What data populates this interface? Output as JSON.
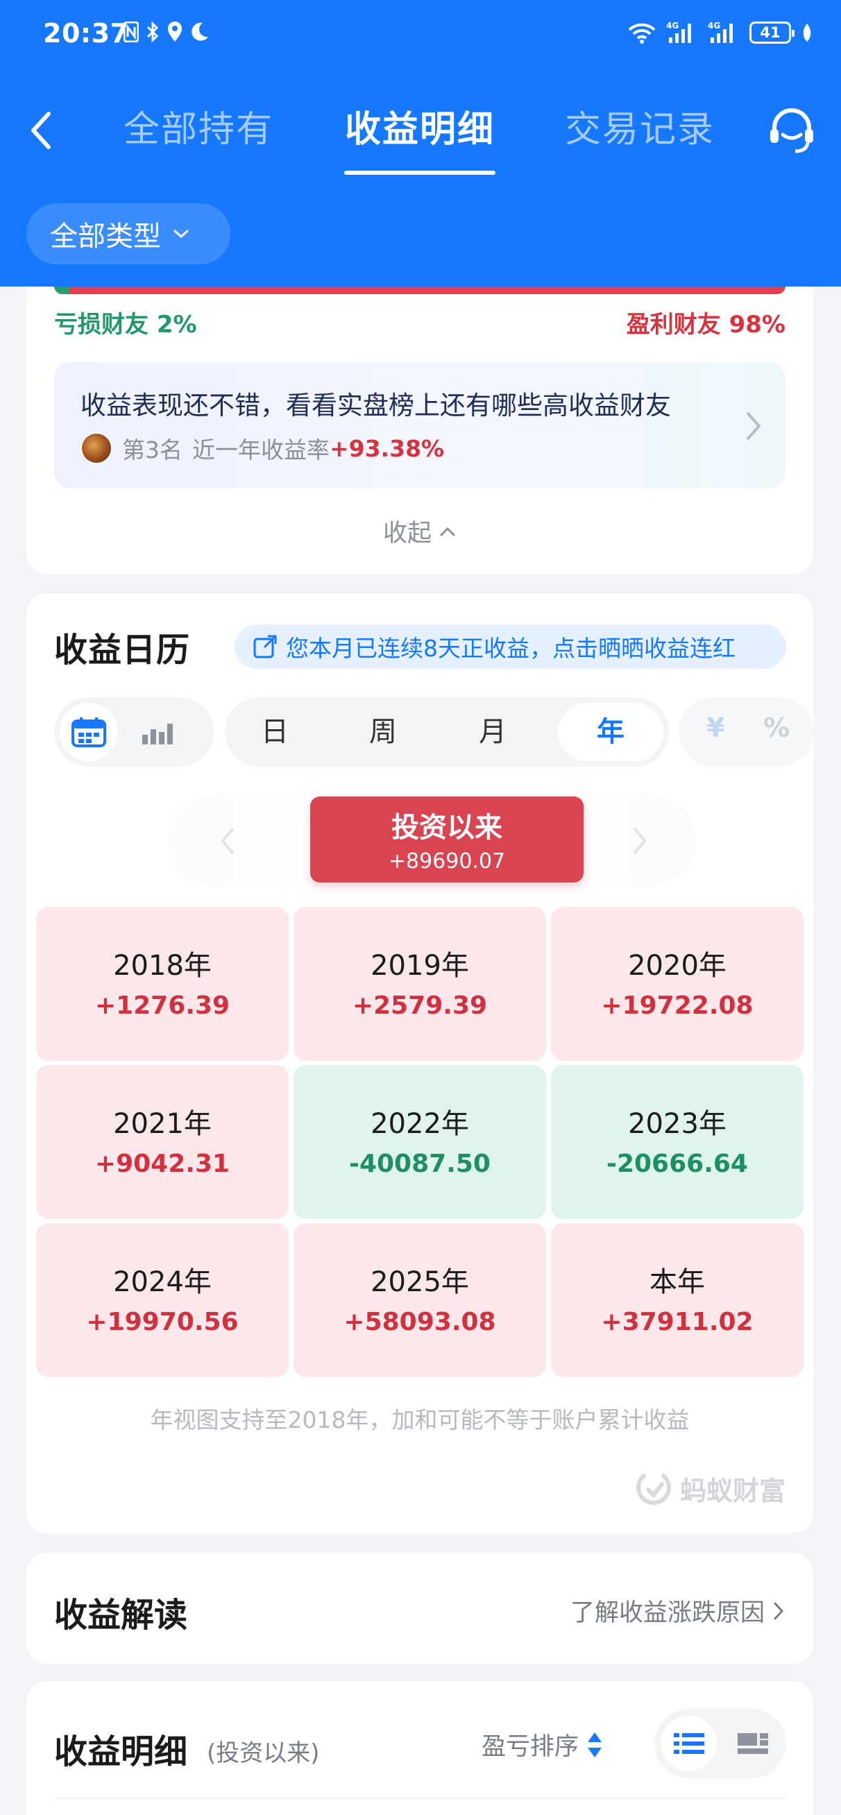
{
  "status_bar": {
    "time": "20:37",
    "network": "4G",
    "battery": "41"
  },
  "nav": {
    "tabs": [
      {
        "label": "全部持有",
        "active": false
      },
      {
        "label": "收益明细",
        "active": true
      },
      {
        "label": "交易记录",
        "active": false
      }
    ]
  },
  "filter": {
    "label": "全部类型"
  },
  "ratio": {
    "loss_label": "亏损财友 2%",
    "gain_label": "盈利财友 98%",
    "loss_fraction": 0.02,
    "colors": {
      "loss": "#22a06b",
      "gain": "#e43f4f"
    }
  },
  "promo": {
    "title": "收益表现还不错，看看实盘榜上还有哪些高收益财友",
    "rank": "第3名",
    "rate_label": "近一年收益率",
    "rate_value": "+93.38%"
  },
  "collapse_label": "收起",
  "calendar": {
    "title": "收益日历",
    "streak_text": "您本月已连续8天正收益，点击晒晒收益连红",
    "periods": [
      {
        "label": "日",
        "active": false
      },
      {
        "label": "周",
        "active": false
      },
      {
        "label": "月",
        "active": false
      },
      {
        "label": "年",
        "active": true
      }
    ],
    "units": {
      "currency": "¥",
      "percent": "%"
    },
    "since": {
      "label": "投资以来",
      "value": "+89690.07"
    },
    "years": [
      {
        "year": "2018年",
        "value": "+1276.39",
        "sign": "pos"
      },
      {
        "year": "2019年",
        "value": "+2579.39",
        "sign": "pos"
      },
      {
        "year": "2020年",
        "value": "+19722.08",
        "sign": "pos"
      },
      {
        "year": "2021年",
        "value": "+9042.31",
        "sign": "pos"
      },
      {
        "year": "2022年",
        "value": "-40087.50",
        "sign": "neg"
      },
      {
        "year": "2023年",
        "value": "-20666.64",
        "sign": "neg"
      },
      {
        "year": "2024年",
        "value": "+19970.56",
        "sign": "pos"
      },
      {
        "year": "2025年",
        "value": "+58093.08",
        "sign": "pos"
      },
      {
        "year": "本年",
        "value": "+37911.02",
        "sign": "pos"
      }
    ],
    "note": "年视图支持至2018年，加和可能不等于账户累计收益",
    "brand": "蚂蚁财富"
  },
  "interpretation": {
    "title": "收益解读",
    "link": "了解收益涨跌原因"
  },
  "detail": {
    "title": "收益明细",
    "subtitle": "(投资以来)",
    "sort_label": "盈亏排序"
  },
  "colors": {
    "brand_blue": "#1677ff",
    "positive_red": "#d1313f",
    "negative_green": "#1d8f63"
  }
}
